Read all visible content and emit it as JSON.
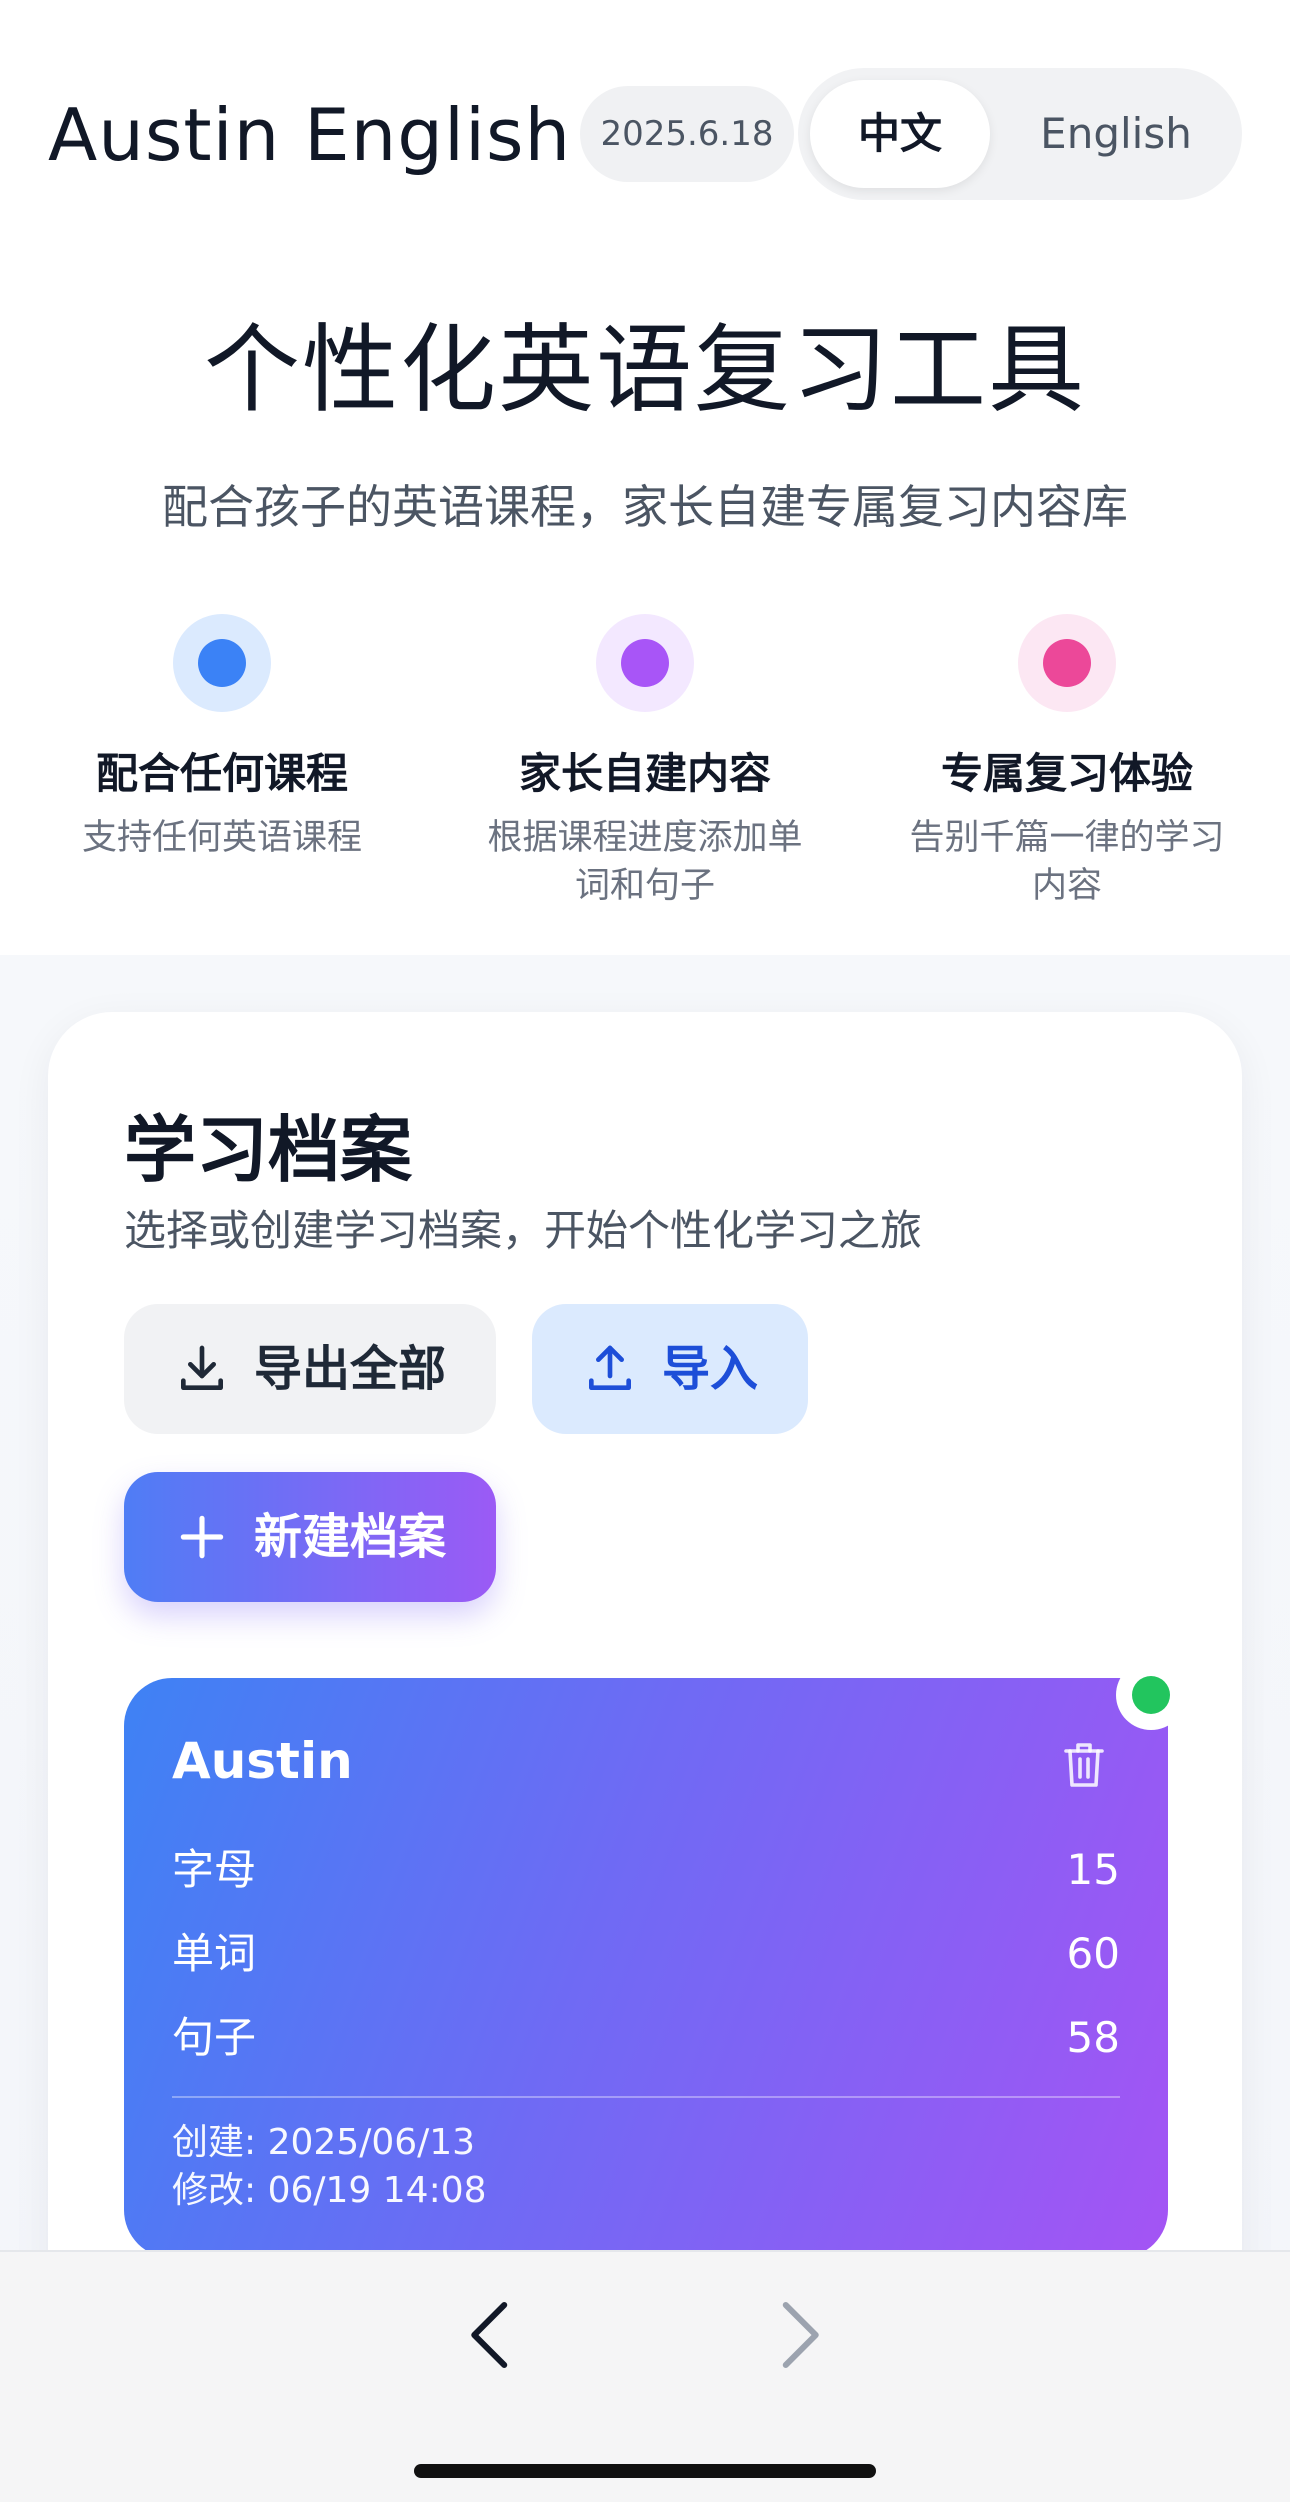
{
  "header": {
    "app_title": "Austin English",
    "date": "2025.6.18",
    "lang_zh": "中文",
    "lang_en": "English"
  },
  "hero": {
    "title": "个性化英语复习工具",
    "subtitle": "配合孩子的英语课程，家长自建专属复习内容库"
  },
  "features": [
    {
      "title": "配合任何课程",
      "desc": "支持任何英语课程",
      "color": "#3b82f6",
      "bg": "#dbeafe"
    },
    {
      "title": "家长自建内容",
      "desc_line1": "根据课程进度添加单",
      "desc_line2": "词和句子",
      "color": "#a855f7",
      "bg": "#f3e8ff"
    },
    {
      "title": "专属复习体验",
      "desc_line1": "告别千篇一律的学习",
      "desc_line2": "内容",
      "color": "#ec4899",
      "bg": "#fce7f3"
    }
  ],
  "profiles_panel": {
    "title": "学习档案",
    "subtitle": "选择或创建学习档案，开始个性化学习之旅",
    "export_label": "导出全部",
    "import_label": "导入",
    "new_label": "新建档案"
  },
  "profile_card": {
    "name": "Austin",
    "active": true,
    "stats": [
      {
        "label": "字母",
        "value": "15"
      },
      {
        "label": "单词",
        "value": "60"
      },
      {
        "label": "句子",
        "value": "58"
      }
    ],
    "created": "创建: 2025/06/13",
    "modified": "修改: 06/19 14:08"
  },
  "nav": {
    "back_icon": "chevron-left-icon",
    "forward_icon": "chevron-right-icon"
  },
  "colors": {
    "accent_blue": "#3e82f4",
    "accent_purple": "#a454f4",
    "active_green": "#22c55e"
  }
}
